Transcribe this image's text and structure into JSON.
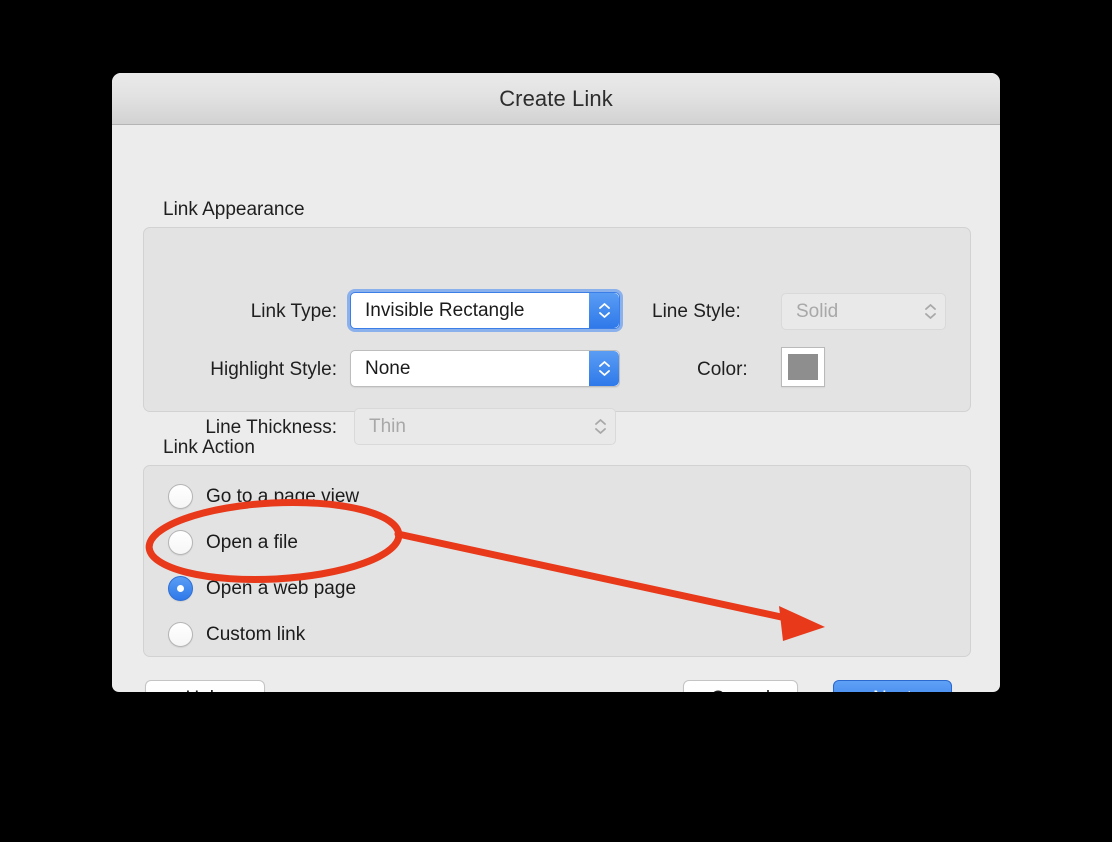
{
  "window": {
    "title": "Create Link"
  },
  "appearance": {
    "group_label": "Link Appearance",
    "link_type": {
      "label": "Link Type:",
      "value": "Invisible Rectangle"
    },
    "highlight_style": {
      "label": "Highlight Style:",
      "value": "None"
    },
    "line_thickness": {
      "label": "Line Thickness:",
      "value": "Thin"
    },
    "line_style": {
      "label": "Line Style:",
      "value": "Solid"
    },
    "color": {
      "label": "Color:",
      "swatch_hex": "#8e8e8e"
    }
  },
  "action": {
    "group_label": "Link Action",
    "options": [
      {
        "label": "Go to a page view",
        "selected": false
      },
      {
        "label": "Open a file",
        "selected": false
      },
      {
        "label": "Open a web page",
        "selected": true
      },
      {
        "label": "Custom link",
        "selected": false
      }
    ]
  },
  "footer": {
    "help_label": "Help",
    "cancel_label": "Cancel",
    "next_label": "Next"
  },
  "annotation": {
    "highlight_color": "#e8391b",
    "ellipse_target": "Open a web page",
    "arrow_target": "Next"
  }
}
